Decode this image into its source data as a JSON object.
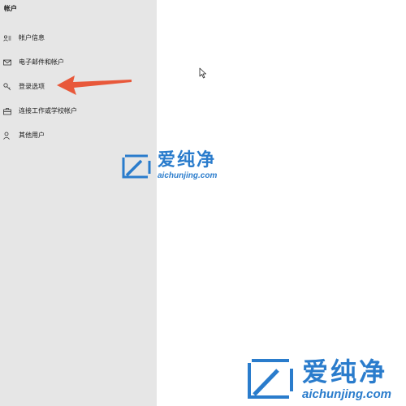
{
  "sidebar": {
    "title": "帐户",
    "items": [
      {
        "label": "帐户信息",
        "icon": "account-info-icon"
      },
      {
        "label": "电子邮件和帐户",
        "icon": "mail-icon"
      },
      {
        "label": "登录选项",
        "icon": "key-icon"
      },
      {
        "label": "连接工作或学校帐户",
        "icon": "briefcase-icon"
      },
      {
        "label": "其他用户",
        "icon": "person-icon"
      }
    ]
  },
  "watermark": {
    "brand_cn": "爱纯净",
    "brand_en": "aichunjing.com",
    "color": "#2a7ccc"
  },
  "annotation": {
    "arrow_color": "#e8583a"
  },
  "colors": {
    "sidebar_bg": "#e6e6e6",
    "main_bg": "#ffffff"
  }
}
